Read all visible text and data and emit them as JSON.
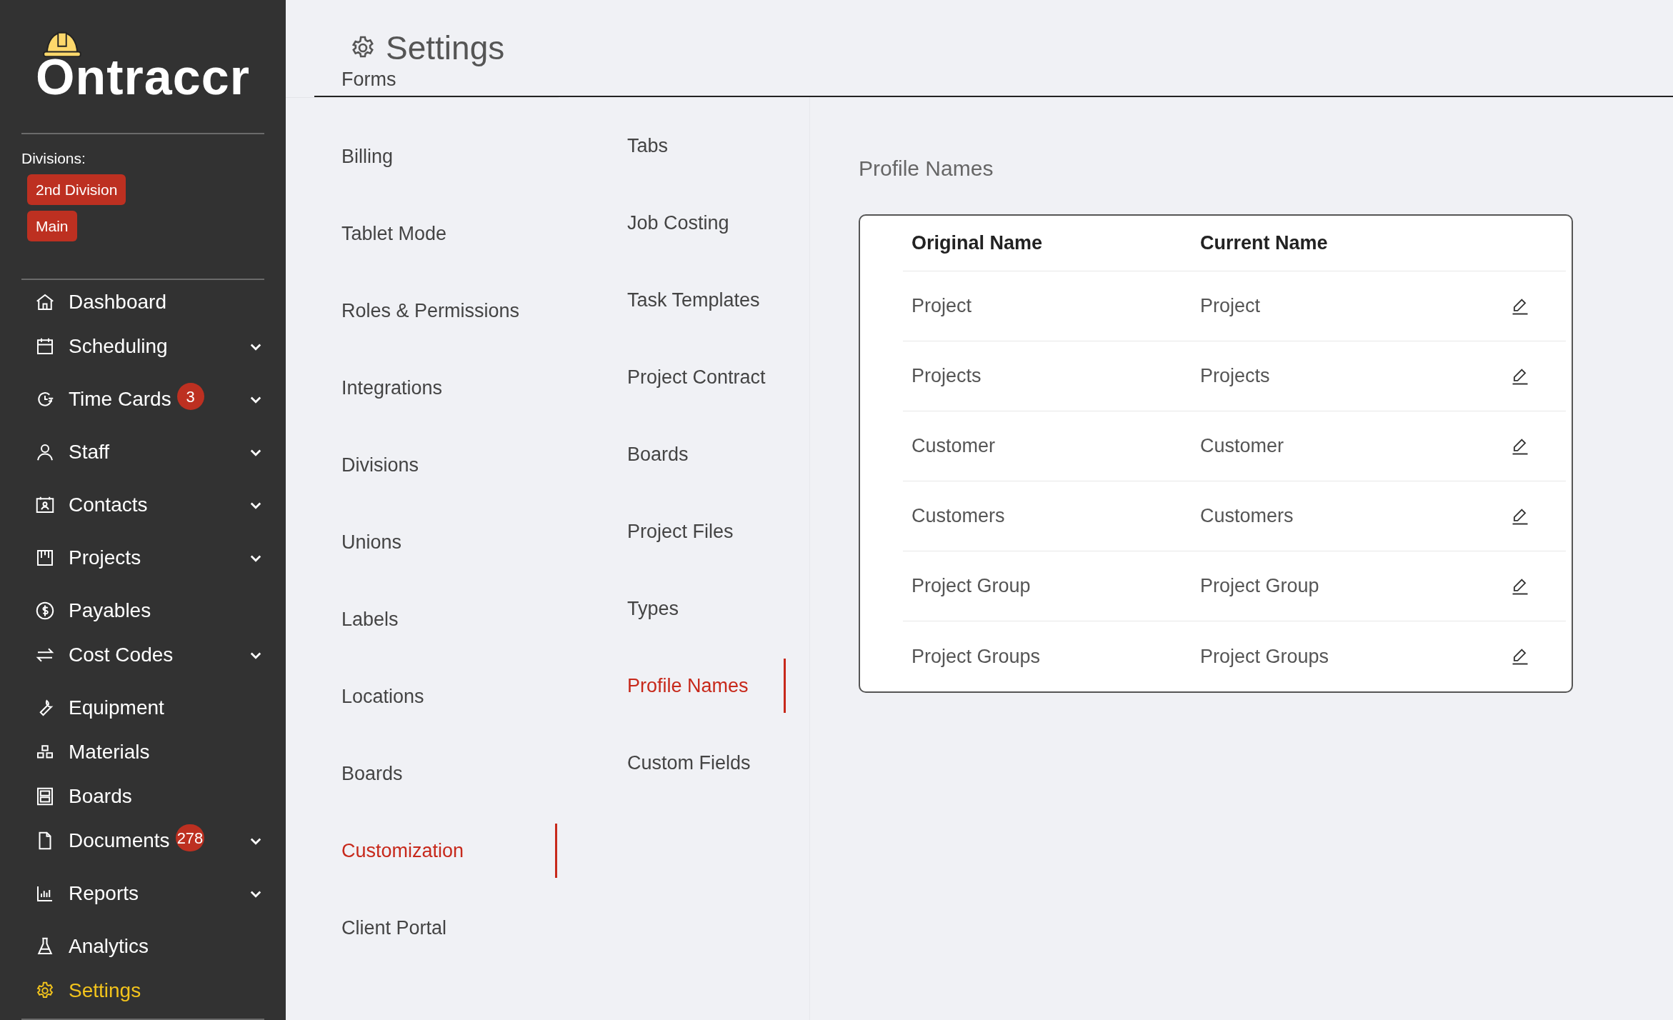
{
  "sidebar": {
    "logo": "Ontraccr",
    "divisions_label": "Divisions:",
    "divisions": [
      "2nd Division",
      "Main"
    ],
    "items": [
      {
        "label": "Dashboard",
        "expandable": false,
        "selected": false
      },
      {
        "label": "Scheduling",
        "expandable": true,
        "selected": false
      },
      {
        "label": "Time Cards",
        "expandable": true,
        "selected": false,
        "badge": "3"
      },
      {
        "label": "Staff",
        "expandable": true,
        "selected": false
      },
      {
        "label": "Contacts",
        "expandable": true,
        "selected": false
      },
      {
        "label": "Projects",
        "expandable": true,
        "selected": false
      },
      {
        "label": "Payables",
        "expandable": false,
        "selected": false
      },
      {
        "label": "Cost Codes",
        "expandable": true,
        "selected": false
      },
      {
        "label": "Equipment",
        "expandable": false,
        "selected": false
      },
      {
        "label": "Materials",
        "expandable": false,
        "selected": false
      },
      {
        "label": "Boards",
        "expandable": false,
        "selected": false
      },
      {
        "label": "Documents",
        "expandable": true,
        "selected": false,
        "badge": "278"
      },
      {
        "label": "Reports",
        "expandable": true,
        "selected": false
      },
      {
        "label": "Analytics",
        "expandable": false,
        "selected": false
      },
      {
        "label": "Settings",
        "expandable": false,
        "selected": true
      }
    ]
  },
  "header": {
    "title": "Settings"
  },
  "settings_menu": [
    {
      "label": "Forms",
      "selected": false
    },
    {
      "label": "Billing",
      "selected": false
    },
    {
      "label": "Tablet Mode",
      "selected": false
    },
    {
      "label": "Roles & Permissions",
      "selected": false
    },
    {
      "label": "Integrations",
      "selected": false
    },
    {
      "label": "Divisions",
      "selected": false
    },
    {
      "label": "Unions",
      "selected": false
    },
    {
      "label": "Labels",
      "selected": false
    },
    {
      "label": "Locations",
      "selected": false
    },
    {
      "label": "Boards",
      "selected": false
    },
    {
      "label": "Customization",
      "selected": true
    },
    {
      "label": "Client Portal",
      "selected": false
    }
  ],
  "customization_menu": [
    {
      "label": "Tabs",
      "selected": false
    },
    {
      "label": "Job Costing",
      "selected": false
    },
    {
      "label": "Task Templates",
      "selected": false
    },
    {
      "label": "Project Contract",
      "selected": false
    },
    {
      "label": "Boards",
      "selected": false
    },
    {
      "label": "Project Files",
      "selected": false
    },
    {
      "label": "Types",
      "selected": false
    },
    {
      "label": "Profile Names",
      "selected": true
    },
    {
      "label": "Custom Fields",
      "selected": false
    }
  ],
  "section_title": "Profile Names",
  "table": {
    "columns": [
      "Original Name",
      "Current Name"
    ],
    "rows": [
      [
        "Project",
        "Project"
      ],
      [
        "Projects",
        "Projects"
      ],
      [
        "Customer",
        "Customer"
      ],
      [
        "Customers",
        "Customers"
      ],
      [
        "Project Group",
        "Project Group"
      ],
      [
        "Project Groups",
        "Project Groups"
      ]
    ]
  }
}
